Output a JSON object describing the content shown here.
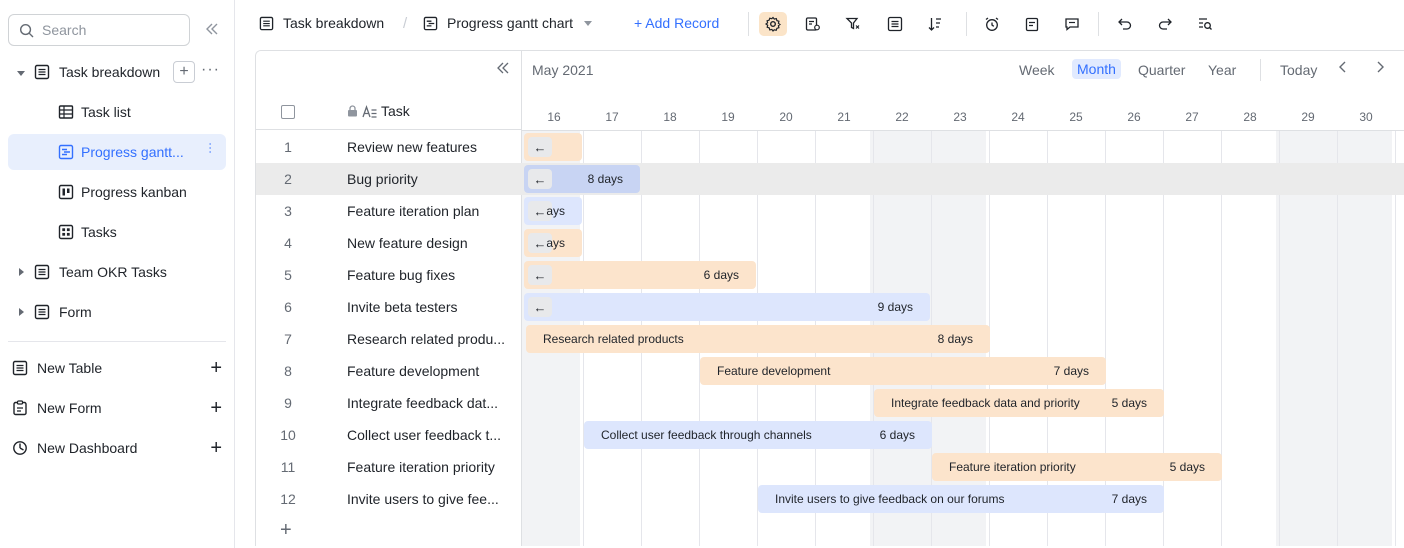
{
  "sidebar": {
    "search_placeholder": "Search",
    "tree": [
      {
        "label": "Task breakdown",
        "icon": "table-icon",
        "level": 0,
        "expanded": true
      },
      {
        "label": "Task list",
        "icon": "grid-view-icon",
        "level": 1
      },
      {
        "label": "Progress gantt...",
        "icon": "gantt-view-icon",
        "level": 1,
        "active": true
      },
      {
        "label": "Progress kanban",
        "icon": "kanban-view-icon",
        "level": 1
      },
      {
        "label": "Tasks",
        "icon": "gallery-view-icon",
        "level": 1
      },
      {
        "label": "Team OKR Tasks",
        "icon": "table-icon",
        "level": 0,
        "expanded": false
      },
      {
        "label": "Form",
        "icon": "table-icon",
        "level": 0,
        "expanded": false
      }
    ],
    "new_items": [
      {
        "label": "New Table",
        "icon": "table-icon"
      },
      {
        "label": "New Form",
        "icon": "form-icon"
      },
      {
        "label": "New Dashboard",
        "icon": "dashboard-icon"
      }
    ]
  },
  "toolbar": {
    "breadcrumb_table": "Task breakdown",
    "breadcrumb_sep": "/",
    "breadcrumb_view": "Progress gantt chart",
    "add_record": "+ Add Record"
  },
  "gantt": {
    "month": "May 2021",
    "scales": [
      "Week",
      "Month",
      "Quarter",
      "Year"
    ],
    "active_scale": "Month",
    "today": "Today",
    "task_header": "Task",
    "days": [
      "16",
      "17",
      "18",
      "19",
      "20",
      "21",
      "22",
      "23",
      "24",
      "25",
      "26",
      "27",
      "28",
      "29",
      "30"
    ],
    "rows": [
      {
        "num": "1",
        "name": "Review new features"
      },
      {
        "num": "2",
        "name": "Bug priority"
      },
      {
        "num": "3",
        "name": "Feature iteration plan"
      },
      {
        "num": "4",
        "name": "New feature design"
      },
      {
        "num": "5",
        "name": "Feature bug fixes"
      },
      {
        "num": "6",
        "name": "Invite beta testers"
      },
      {
        "num": "7",
        "name": "Research related produ..."
      },
      {
        "num": "8",
        "name": "Feature development"
      },
      {
        "num": "9",
        "name": "Integrate feedback dat..."
      },
      {
        "num": "10",
        "name": "Collect user feedback t..."
      },
      {
        "num": "11",
        "name": "Feature iteration priority"
      },
      {
        "num": "12",
        "name": "Invite users to give fee..."
      }
    ],
    "bars": [
      {
        "row": 1,
        "label": "",
        "duration": "",
        "color": "orange"
      },
      {
        "row": 2,
        "label": "",
        "duration": "8 days",
        "color": "blue"
      },
      {
        "row": 3,
        "label": "",
        "duration": "ays",
        "color": "blue"
      },
      {
        "row": 4,
        "label": "",
        "duration": "ays",
        "color": "orange"
      },
      {
        "row": 5,
        "label": "",
        "duration": "6 days",
        "color": "orange"
      },
      {
        "row": 6,
        "label": "",
        "duration": "9 days",
        "color": "blue"
      },
      {
        "row": 7,
        "label": "Research related products",
        "duration": "8 days",
        "color": "orange"
      },
      {
        "row": 8,
        "label": "Feature development",
        "duration": "7 days",
        "color": "orange"
      },
      {
        "row": 9,
        "label": "Integrate feedback data and priority",
        "duration": "5 days",
        "color": "orange"
      },
      {
        "row": 10,
        "label": "Collect user feedback through channels",
        "duration": "6 days",
        "color": "blue"
      },
      {
        "row": 11,
        "label": "Feature iteration priority",
        "duration": "5 days",
        "color": "orange"
      },
      {
        "row": 12,
        "label": "Invite users to give feedback on our forums",
        "duration": "7 days",
        "color": "blue"
      }
    ]
  }
}
